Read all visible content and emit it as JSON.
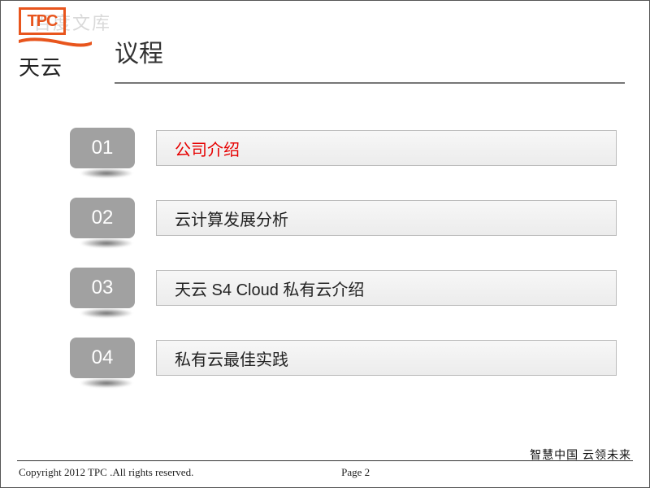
{
  "watermark": "百度文库",
  "logo": {
    "mono": "TPC",
    "brand": "天云"
  },
  "title": "议程",
  "agenda": [
    {
      "num": "01",
      "label": "公司介绍",
      "active": true
    },
    {
      "num": "02",
      "label": "云计算发展分析",
      "active": false
    },
    {
      "num": "03",
      "label": "天云 S4 Cloud 私有云介绍",
      "active": false
    },
    {
      "num": "04",
      "label": "私有云最佳实践",
      "active": false
    }
  ],
  "footer": {
    "tagline": "智慧中国  云领未来",
    "copyright": "Copyright 2012 TPC .All rights reserved.",
    "page": "Page 2"
  }
}
